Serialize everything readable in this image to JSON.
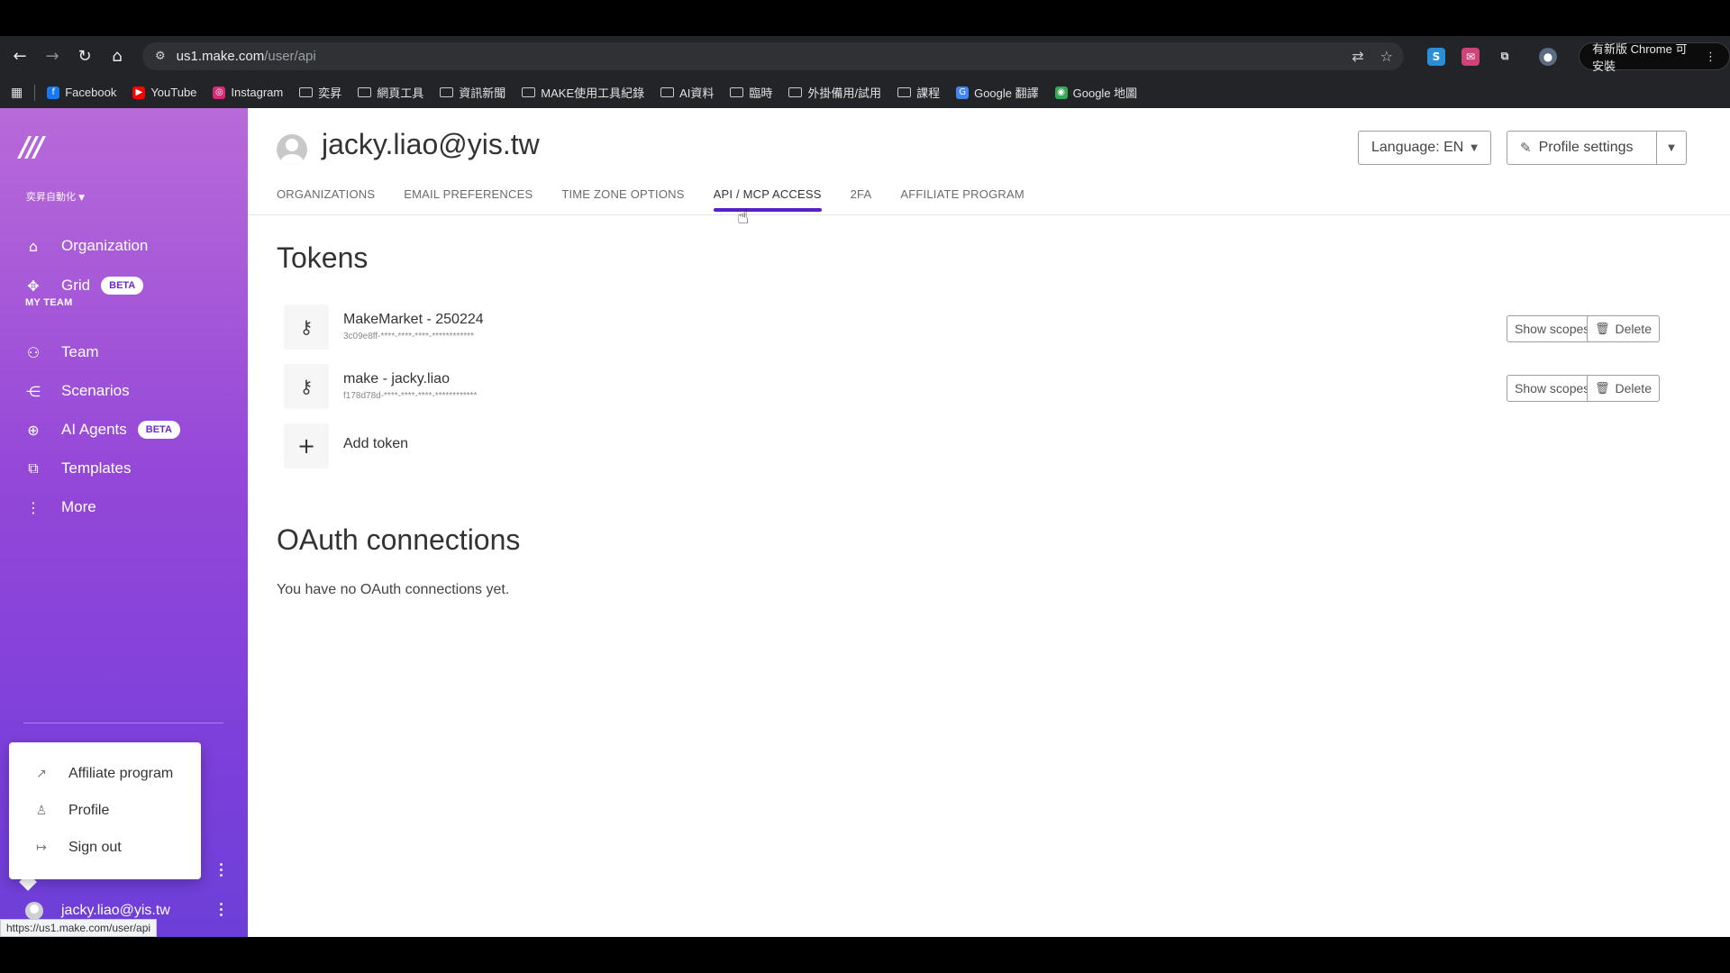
{
  "browser": {
    "url_host": "us1.make.com",
    "url_path": "/user/api",
    "update_label": "有新版 Chrome 可安裝",
    "bookmarks": [
      {
        "label": "Facebook",
        "icon": "facebook-icon",
        "color": "#1877f2"
      },
      {
        "label": "YouTube",
        "icon": "youtube-icon",
        "color": "#ff0000"
      },
      {
        "label": "Instagram",
        "icon": "instagram-icon",
        "color": "#d62976"
      },
      {
        "label": "奕昇",
        "icon": "folder-icon"
      },
      {
        "label": "網頁工具",
        "icon": "folder-icon"
      },
      {
        "label": "資訊新聞",
        "icon": "folder-icon"
      },
      {
        "label": "MAKE使用工具紀錄",
        "icon": "folder-icon"
      },
      {
        "label": "AI資料",
        "icon": "folder-icon"
      },
      {
        "label": "臨時",
        "icon": "folder-icon"
      },
      {
        "label": "外掛備用/試用",
        "icon": "folder-icon"
      },
      {
        "label": "課程",
        "icon": "folder-icon"
      },
      {
        "label": "Google 翻譯",
        "icon": "google-translate-icon",
        "color": "#4285f4"
      },
      {
        "label": "Google 地圖",
        "icon": "google-maps-icon",
        "color": "#34a853"
      }
    ],
    "status_url": "https://us1.make.com/user/api"
  },
  "sidebar": {
    "org_name": "奕昇自動化",
    "section_label": "MY TEAM",
    "items": [
      {
        "label": "Organization",
        "icon": "home-icon"
      },
      {
        "label": "Grid",
        "icon": "grid-icon",
        "badge": "BETA"
      },
      {
        "label": "Team",
        "icon": "team-icon"
      },
      {
        "label": "Scenarios",
        "icon": "share-icon"
      },
      {
        "label": "AI Agents",
        "icon": "ai-agent-icon",
        "badge": "BETA"
      },
      {
        "label": "Templates",
        "icon": "templates-icon"
      },
      {
        "label": "More",
        "icon": "more-icon"
      }
    ],
    "popup": [
      {
        "label": "Affiliate program",
        "icon": "chart-icon"
      },
      {
        "label": "Profile",
        "icon": "user-icon"
      },
      {
        "label": "Sign out",
        "icon": "sign-out-icon"
      }
    ],
    "user_email": "jacky.liao@yis.tw"
  },
  "header": {
    "title": "jacky.liao@yis.tw",
    "language_label": "Language: EN",
    "profile_settings_label": "Profile settings"
  },
  "tabs": [
    {
      "label": "ORGANIZATIONS",
      "active": false
    },
    {
      "label": "EMAIL PREFERENCES",
      "active": false
    },
    {
      "label": "TIME ZONE OPTIONS",
      "active": false
    },
    {
      "label": "API / MCP ACCESS",
      "active": true
    },
    {
      "label": "2FA",
      "active": false
    },
    {
      "label": "AFFILIATE PROGRAM",
      "active": false
    }
  ],
  "tokens": {
    "title": "Tokens",
    "items": [
      {
        "name": "MakeMarket - 250224",
        "key": "3c09e8ff-****-****-****-************"
      },
      {
        "name": "make - jacky.liao",
        "key": "f178d78d-****-****-****-************"
      }
    ],
    "show_scopes_label": "Show scopes",
    "delete_label": "Delete",
    "add_label": "Add token"
  },
  "oauth": {
    "title": "OAuth connections",
    "empty_text": "You have no OAuth connections yet."
  },
  "colors": {
    "accent": "#5a1fc4",
    "sidebar_top": "#b86ad9",
    "sidebar_bottom": "#6d3fd8"
  }
}
